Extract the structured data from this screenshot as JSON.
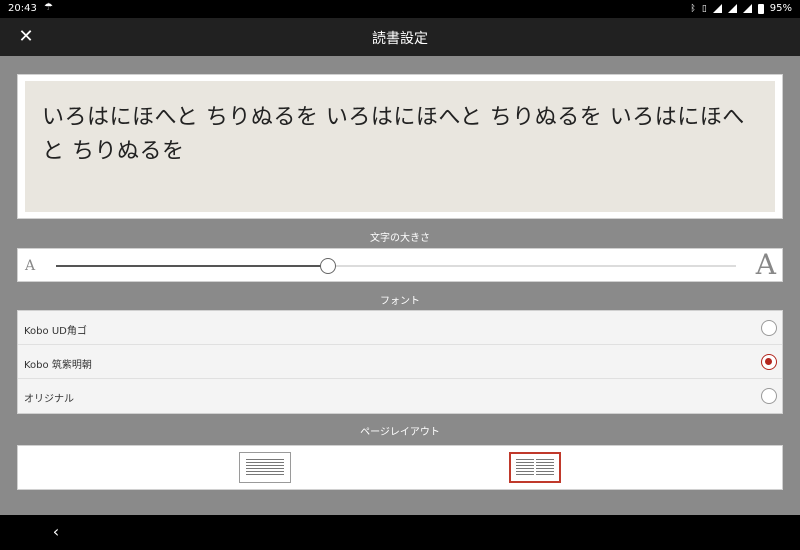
{
  "status_bar": {
    "time": "20:43",
    "notification": "☂",
    "battery_percent": "95%",
    "icons": [
      "bluetooth-icon",
      "vibrate-icon",
      "wifi-icon",
      "signal-icon",
      "signal-icon",
      "battery-icon"
    ]
  },
  "app_bar": {
    "close_label": "✕",
    "title": "読書設定"
  },
  "preview": {
    "text": "いろはにほへと ちりぬるを いろはにほへと ちりぬるを いろはにほへと ちりぬるを"
  },
  "font_size": {
    "label": "文字の大きさ",
    "small_glyph": "A",
    "large_glyph": "A",
    "level": 0.4
  },
  "font": {
    "label": "フォント",
    "options": [
      {
        "name": "Kobo UD角ゴ",
        "selected": false
      },
      {
        "name": "Kobo 筑紫明朝",
        "selected": true
      },
      {
        "name": "オリジナル",
        "selected": false
      }
    ]
  },
  "page_layout": {
    "label": "ページレイアウト",
    "options": [
      {
        "name": "single-column",
        "selected": false
      },
      {
        "name": "two-column",
        "selected": true
      }
    ]
  },
  "nav": {
    "back_label": "‹"
  },
  "colors": {
    "accent": "#b3261e",
    "app_bar": "#212121",
    "content_bg": "#8a8a8a",
    "preview_bg": "#e9e6df"
  }
}
